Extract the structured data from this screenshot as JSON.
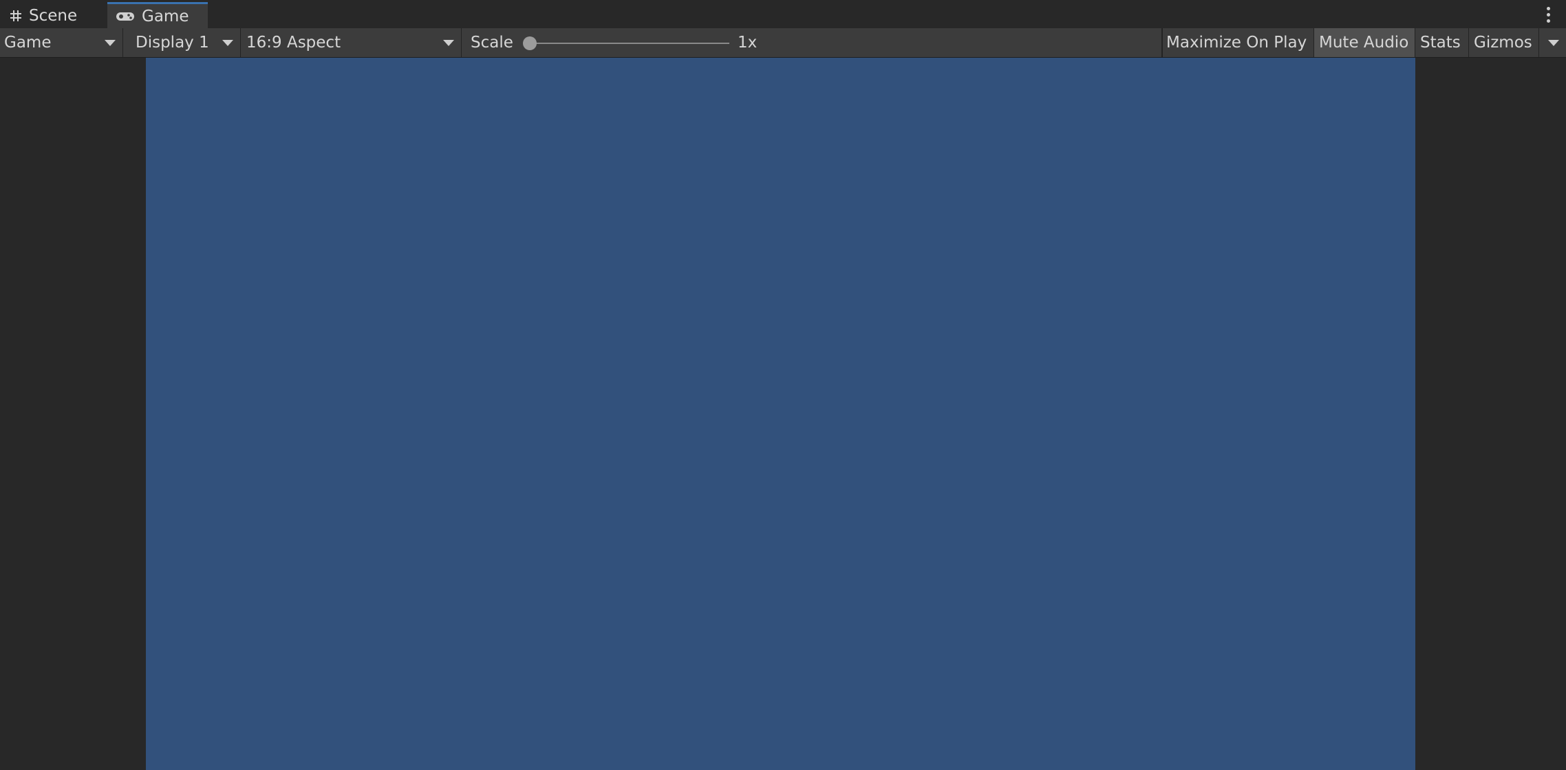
{
  "tabs": [
    {
      "label": "Scene",
      "icon": "grid-icon",
      "active": false
    },
    {
      "label": "Game",
      "icon": "gamepad-icon",
      "active": true
    }
  ],
  "toolbar": {
    "view_mode": "Game",
    "display": "Display 1",
    "aspect": "16:9 Aspect",
    "scale_label": "Scale",
    "scale_value": "1x",
    "scale_fraction": 0.0,
    "maximize_on_play": "Maximize On Play",
    "mute_audio": "Mute Audio",
    "mute_audio_on": true,
    "stats": "Stats",
    "gizmos": "Gizmos"
  },
  "colors": {
    "game_background": "#32517c",
    "accent": "#3a72b0"
  }
}
